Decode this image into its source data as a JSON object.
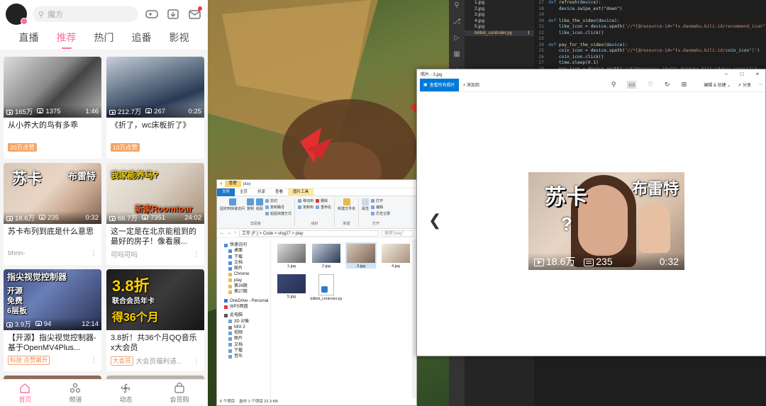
{
  "phone": {
    "search_placeholder": "魔方",
    "tabs": [
      "直播",
      "推荐",
      "热门",
      "追番",
      "影视"
    ],
    "active_tab": 1,
    "cards": [
      {
        "views": "165万",
        "danmaku": "1375",
        "duration": "1:46",
        "title": "从小养大的鸟有多乖",
        "tag": "20万点赞",
        "footer": ""
      },
      {
        "views": "212.7万",
        "danmaku": "267",
        "duration": "0:25",
        "title": "《折了，wc床板折了》",
        "tag": "13万点赞",
        "footer": ""
      },
      {
        "views": "18.6万",
        "danmaku": "235",
        "duration": "0:32",
        "title": "苏卡布列到底是什么意思",
        "tag": "",
        "footer": "bhnn-",
        "overlay1": "苏卡",
        "overlay2": "布雷特"
      },
      {
        "views": "66.7万",
        "danmaku": "7351",
        "duration": "24:02",
        "title": "这一定是在北京能租到的最好的房子！像看展...",
        "tag": "",
        "footer": "可吗可吗",
        "overlay1": "我家能养马?",
        "overlay2": "新家Roomtour"
      },
      {
        "views": "3.9万",
        "danmaku": "94",
        "duration": "12:14",
        "title": "【开源】指尖视觉控制器-基于OpenMV4Plus...",
        "tag": "",
        "footer_tag": "科技 点赞飙升",
        "overlay1": "指尖视觉控制器",
        "overlay2": "开源 免费 6层板"
      },
      {
        "views": "",
        "danmaku": "",
        "duration": "",
        "title": "3.8折！共36个月QQ音乐x大会员",
        "tag": "",
        "footer_tag": "大会员",
        "footer": "大会员福利请...",
        "overlay1": "3.8折",
        "overlay2": "联合会员年卡",
        "overlay3": "得36个月"
      }
    ],
    "nav": [
      "首页",
      "频道",
      "动态",
      "会员购"
    ]
  },
  "vscode": {
    "files": [
      "1.jpg",
      "2.jpg",
      "3.jpg",
      "4.jpg",
      "5.jpg",
      "bilibili_controler.py"
    ],
    "selected_file_badge": "1",
    "code": [
      {
        "n": "17",
        "code": "def refresh(device):"
      },
      {
        "n": "18",
        "code": "    device.swipe_ext(\"down\")"
      },
      {
        "n": "19",
        "code": ""
      },
      {
        "n": "20",
        "code": "def like_the_video(device):"
      },
      {
        "n": "21",
        "code": "    like_icon = device.xpath('//*[@resource-id=\"tv.danmaku.bili:id/recommend_icon\"]')"
      },
      {
        "n": "22",
        "code": "    like_icon.click()"
      },
      {
        "n": "23",
        "code": ""
      },
      {
        "n": "24",
        "code": "def pay_for_the_video(device):"
      },
      {
        "n": "25",
        "code": "    coin_icon = device.xpath('//*[@resource-id=\"tv.danmaku.bili:id/coin_icon\"]')"
      },
      {
        "n": "26",
        "code": "    coin_icon.click()"
      },
      {
        "n": "27",
        "code": "    time.sleep(0.1)"
      },
      {
        "n": "28",
        "code": "    pay_icon = device.xpath('//*[@resource-id=\"tv.danmaku.bili:id/pay_coins\"]')"
      }
    ]
  },
  "explorer": {
    "manage_tab": "管理",
    "folder_title": "play",
    "tabs": [
      "文件",
      "主页",
      "共享",
      "查看",
      "图片工具"
    ],
    "ribbon_groups": [
      {
        "name": "剪贴板",
        "items": [
          "固定到快速访问",
          "复制",
          "粘贴",
          "剪切",
          "复制路径",
          "粘贴快捷方式"
        ]
      },
      {
        "name": "组织",
        "items": [
          "移动到",
          "复制到",
          "删除",
          "重命名"
        ]
      },
      {
        "name": "新建",
        "items": [
          "新建文件夹"
        ]
      },
      {
        "name": "打开",
        "items": [
          "属性",
          "打开",
          "编辑",
          "历史记录"
        ]
      }
    ],
    "path": "工作 (F:) > Code > vlog27 > play",
    "search_placeholder": "搜索\"play\"",
    "nav": [
      "快速访问",
      "桌面",
      "下载",
      "文档",
      "图片",
      "Chrome",
      "play",
      "第26期",
      "第27期",
      "OneDrive - Personal",
      "WPS网盘",
      "此电脑",
      "3D 对象",
      "MIX 2",
      "视频",
      "图片",
      "文档",
      "下载",
      "音乐"
    ],
    "files": [
      "1.jpg",
      "2.jpg",
      "3.jpg",
      "4.jpg",
      "5.jpg",
      "bilibili_controler.py"
    ],
    "status_count": "6 个项目",
    "status_selected": "选中 1 个项目 22.3 KB"
  },
  "photos": {
    "title": "照片 - 3.jpg",
    "see_all": "查看所有照片",
    "add_to": "+ 添加到",
    "edit_create": "编辑 & 创建",
    "share": "分享",
    "image_views": "18.6万",
    "image_danmaku": "235",
    "image_duration": "0:32",
    "image_overlay1": "苏卡",
    "image_overlay2": "布雷特"
  }
}
